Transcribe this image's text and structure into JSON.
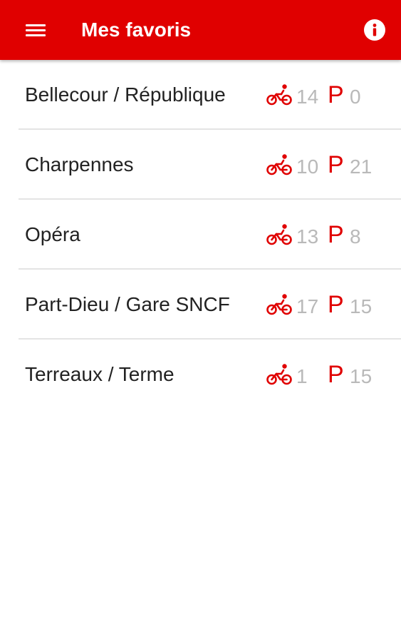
{
  "app_bar": {
    "title": "Mes favoris",
    "menu_icon": "hamburger-menu-icon",
    "info_icon": "info-icon",
    "color": "#e00000"
  },
  "favorites": [
    {
      "name": "Bellecour / République",
      "bikes": "14",
      "parking_label": "P",
      "stands": "0"
    },
    {
      "name": "Charpennes",
      "bikes": "10",
      "parking_label": "P",
      "stands": "21"
    },
    {
      "name": "Opéra",
      "bikes": "13",
      "parking_label": "P",
      "stands": "8"
    },
    {
      "name": "Part-Dieu / Gare SNCF",
      "bikes": "17",
      "parking_label": "P",
      "stands": "15"
    },
    {
      "name": "Terreaux / Terme",
      "bikes": "1",
      "parking_label": "P",
      "stands": "15"
    }
  ],
  "colors": {
    "accent": "#e00000",
    "count_text": "#b9b9b9",
    "name_text": "#222222",
    "divider": "#e4e4e4"
  },
  "icons": {
    "bikes": "bicycle-icon"
  }
}
